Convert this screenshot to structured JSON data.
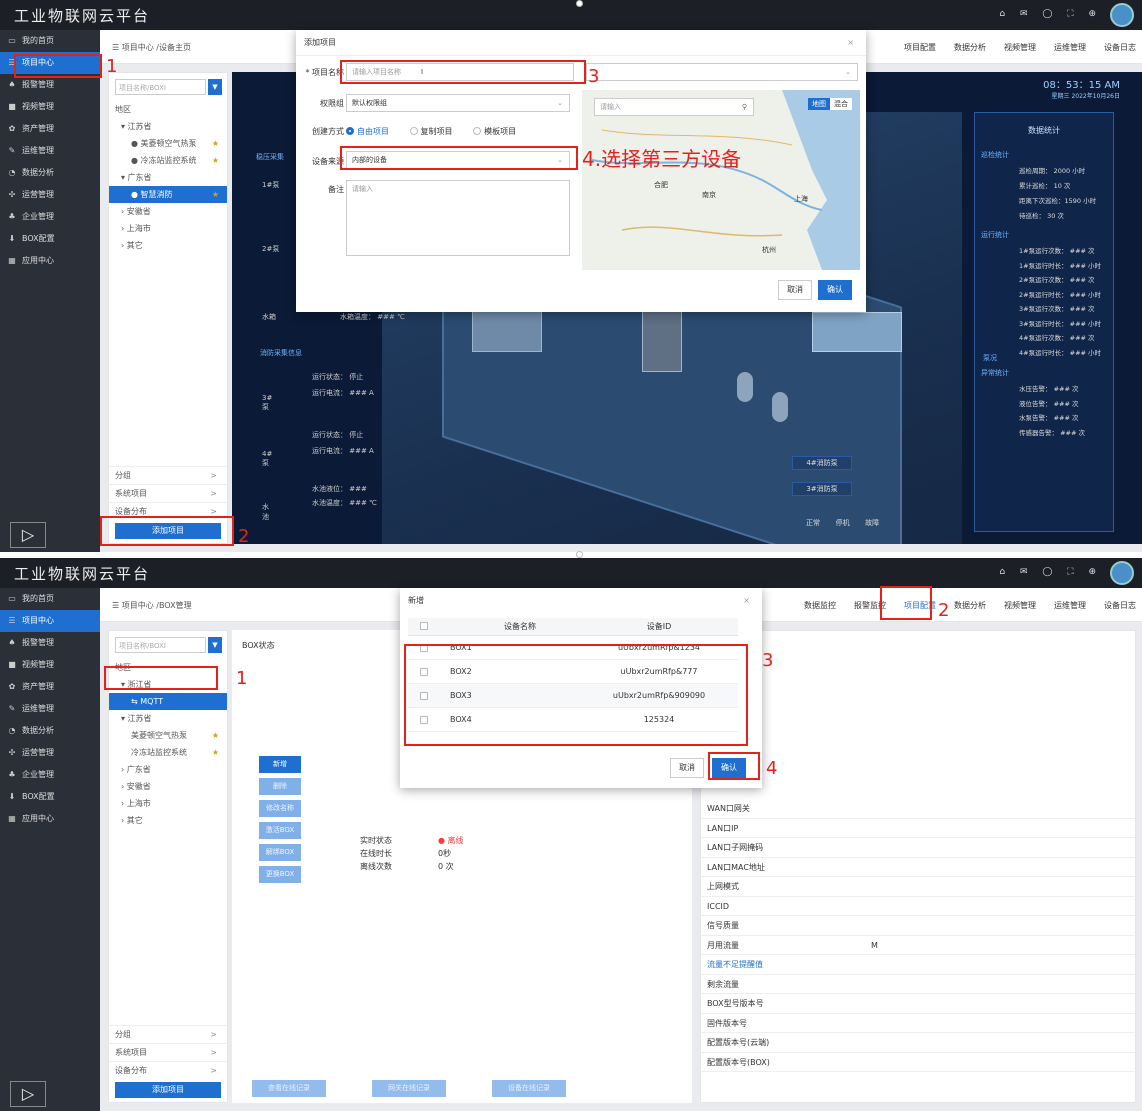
{
  "app": {
    "brand": "工业物联网云平台",
    "top_icons": "⌂ ✉ ◯ ⛶ ⊕"
  },
  "sidebar": [
    {
      "icon": "monitor-icon",
      "glyph": "▭",
      "label": "我的首页"
    },
    {
      "icon": "list-icon",
      "glyph": "☰",
      "label": "项目中心"
    },
    {
      "icon": "bell-icon",
      "glyph": "♠",
      "label": "报警管理"
    },
    {
      "icon": "video-icon",
      "glyph": "■",
      "label": "视频管理"
    },
    {
      "icon": "asset-icon",
      "glyph": "✿",
      "label": "资产管理"
    },
    {
      "icon": "wrench-icon",
      "glyph": "✎",
      "label": "运维管理"
    },
    {
      "icon": "chart-icon",
      "glyph": "◔",
      "label": "数据分析"
    },
    {
      "icon": "settings-icon",
      "glyph": "✣",
      "label": "运营管理"
    },
    {
      "icon": "enterprise-icon",
      "glyph": "♣",
      "label": "企业管理"
    },
    {
      "icon": "box-icon",
      "glyph": "⬇",
      "label": "BOX配置"
    },
    {
      "icon": "apps-icon",
      "glyph": "▦",
      "label": "应用中心"
    }
  ],
  "tree_search_placeholder": "项目名称/BOXI",
  "tree_footer": [
    "分组",
    "系统项目",
    "设备分布"
  ],
  "add_project_label": "添加项目",
  "annotation_numbers": {
    "n1": "1",
    "n2": "2",
    "n3": "3",
    "n4": "4"
  },
  "s1": {
    "breadcrumb": "☰  项目中心 /设备主页",
    "top_nav": [
      "项目配置",
      "数据分析",
      "视频管理",
      "运维管理",
      "设备日志"
    ],
    "tree": [
      {
        "text": "地区",
        "level": 0
      },
      {
        "text": "▾ 江苏省",
        "level": 1
      },
      {
        "text": "● 美菱顿空气热泵",
        "level": 2,
        "star": "★",
        "dot": "#2ecc40"
      },
      {
        "text": "● 冷冻站监控系统",
        "level": 2,
        "star": "★",
        "dot": "#e3221c"
      },
      {
        "text": "▾ 广东省",
        "level": 1
      },
      {
        "text": "● 智慧消防",
        "level": 2,
        "star": "★",
        "selected": true,
        "dot": "#e3221c"
      },
      {
        "text": "› 安徽省",
        "level": 1
      },
      {
        "text": "› 上海市",
        "level": 1
      },
      {
        "text": "› 其它",
        "level": 1
      }
    ],
    "dashboard": {
      "clock": "08：53：15 AM",
      "date": "星期三  2022年10月26日",
      "left_header": "稳压采集",
      "pumps": [
        {
          "name": "1#泵"
        },
        {
          "name": "2#泵"
        }
      ],
      "water_tank": "水箱",
      "tank_temp": "水箱温度：  ###  ℃",
      "fire_header": "消防采集信息",
      "fire_pumps": [
        {
          "name": "3#泵",
          "status": "运行状态：  停止",
          "current": "运行电流：  ###  A"
        },
        {
          "name": "4#泵",
          "status": "运行状态：  停止",
          "current": "运行电流：  ###  A"
        }
      ],
      "pool": "水池",
      "pool_level": "水池液位：  ###",
      "pool_temp": "水池温度：  ###  ℃",
      "right_title": "数据统计",
      "patrol_header": "巡检统计",
      "patrol": [
        "巡检周期：  2000  小时",
        "累计巡检：  10  次",
        "距离下次巡检：1590  小时",
        "待巡检：  30  次"
      ],
      "run_header": "运行统计",
      "pump_label": "泵况",
      "run": [
        "1#泵运行次数：  ###  次",
        "1#泵运行时长：  ###  小时",
        "2#泵运行次数：  ###  次",
        "2#泵运行时长：  ###  小时",
        "3#泵运行次数：  ###  次",
        "3#泵运行时长：  ###  小时",
        "4#泵运行次数：  ###  次",
        "4#泵运行时长：  ###  小时"
      ],
      "alarm_header": "异常统计",
      "alarms": [
        "水压告警：  ###  次",
        "液位告警：  ###  次",
        "水泵告警：  ###  次",
        "传感器告警：  ###  次"
      ],
      "pump4_tag": "4#消防泵",
      "pump3_tag": "3#消防泵",
      "legend": [
        "正常",
        "停机",
        "故障"
      ]
    },
    "modal": {
      "title": "添加项目",
      "close": "×",
      "name_label": "* 项目名称",
      "name_placeholder": "请输入项目名称",
      "perm_label": "权限组",
      "perm_value": "默认权限组",
      "create_label": "创建方式",
      "create_options": [
        "自由项目",
        "复制项目",
        "模板项目"
      ],
      "source_label": "设备来源",
      "source_value": "内部的设备",
      "note_label": "备注",
      "note_placeholder": "请输入",
      "map_search_placeholder": "请输入",
      "map_tabs": [
        "地图",
        "混合"
      ],
      "map_cities": [
        "合肥",
        "上海",
        "杭州",
        "南京"
      ],
      "cancel": "取消",
      "confirm": "确认"
    },
    "annotation_text": "4.选择第三方设备"
  },
  "s2": {
    "breadcrumb": "☰  项目中心 /BOX管理",
    "top_nav": [
      "数据监控",
      "报警监控",
      "项目配置",
      "数据分析",
      "视频管理",
      "运维管理",
      "设备日志"
    ],
    "tree": [
      {
        "text": "地区",
        "level": 0
      },
      {
        "text": "▾ 浙江省",
        "level": 1
      },
      {
        "text": "⇆ MQTT",
        "level": 2,
        "selected": true
      },
      {
        "text": "▾ 江苏省",
        "level": 1
      },
      {
        "text": "美菱顿空气热泵",
        "level": 2,
        "star": "★"
      },
      {
        "text": "冷冻站监控系统",
        "level": 2,
        "star": "★"
      },
      {
        "text": "› 广东省",
        "level": 1
      },
      {
        "text": "› 安徽省",
        "level": 1
      },
      {
        "text": "› 上海市",
        "level": 1
      },
      {
        "text": "› 其它",
        "level": 1
      }
    ],
    "box_status_title": "BOX状态",
    "box_buttons": [
      "新增",
      "删除",
      "修改名称",
      "激活BOX",
      "解绑BOX",
      "更换BOX"
    ],
    "status_rows": [
      [
        "实时状态",
        "● 离线"
      ],
      [
        "在线时长",
        "0秒"
      ],
      [
        "离线次数",
        "0 次"
      ]
    ],
    "right_rows": [
      "WAN口网关",
      "LAN口IP",
      "LAN口子网掩码",
      "LAN口MAC地址",
      "上网模式",
      "ICCID",
      "信号质量",
      "月用流量",
      "流量不足提醒值",
      "剩余流量",
      "BOX型号版本号",
      "固件版本号",
      "配置版本号(云端)",
      "配置版本号(BOX)"
    ],
    "monthly_unit": "M",
    "bottom_buttons": [
      "查看在线记录",
      "网关在线记录",
      "设备在线记录"
    ],
    "modal": {
      "title": "新增",
      "close": "×",
      "col_name": "设备名称",
      "col_id": "设备ID",
      "rows": [
        {
          "name": "BOX1",
          "id": "uUbxr2umRfp&1234"
        },
        {
          "name": "BOX2",
          "id": "uUbxr2umRfp&777"
        },
        {
          "name": "BOX3",
          "id": "uUbxr2umRfp&909090"
        },
        {
          "name": "BOX4",
          "id": "125324"
        }
      ],
      "cancel": "取消",
      "confirm": "确认"
    }
  }
}
